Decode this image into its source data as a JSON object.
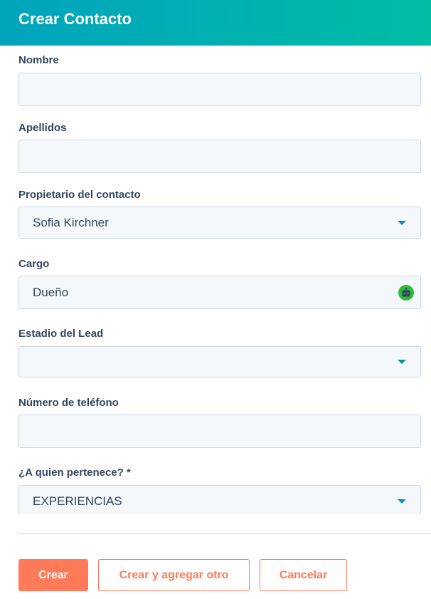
{
  "header": {
    "title": "Crear Contacto"
  },
  "fields": {
    "nombre": {
      "label": "Nombre",
      "value": ""
    },
    "apellidos": {
      "label": "Apellidos",
      "value": ""
    },
    "propietario": {
      "label": "Propietario del contacto",
      "value": "Sofia Kirchner"
    },
    "cargo": {
      "label": "Cargo",
      "value": "Dueño"
    },
    "estadio": {
      "label": "Estadio del Lead",
      "value": ""
    },
    "telefono": {
      "label": "Número de teléfono",
      "value": ""
    },
    "pertenece": {
      "label": "¿A quien pertenece? *",
      "value": "EXPERIENCIAS"
    }
  },
  "buttons": {
    "create": "Crear",
    "create_add": "Crear y agregar otro",
    "cancel": "Cancelar"
  },
  "colors": {
    "header_gradient_start": "#00a4bd",
    "header_gradient_end": "#00bda5",
    "accent": "#ff7a59",
    "caret": "#0091ae",
    "bot_icon": "#2dbb3c"
  }
}
